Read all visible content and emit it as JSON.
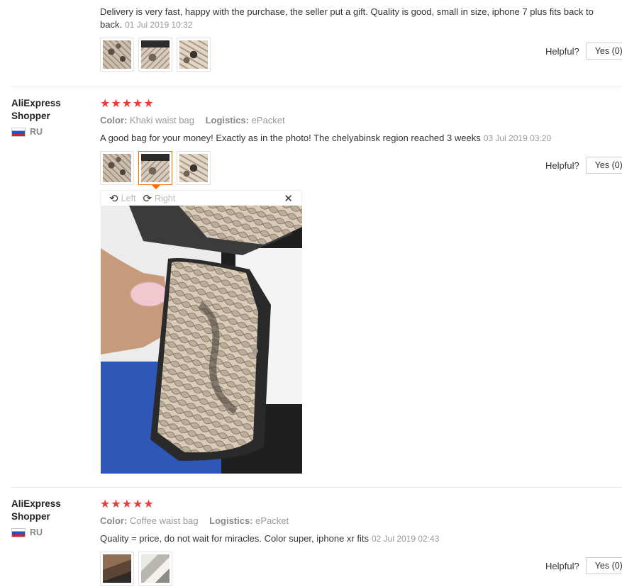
{
  "reviews": [
    {
      "text": "Delivery is very fast, happy with the purchase, the seller put a gift. Quality is good, small in size, iphone 7 plus fits back to back.",
      "date": "01 Jul 2019 10:32",
      "helpful_label": "Helpful?",
      "yes_label": "Yes (0)"
    },
    {
      "reviewer_line1": "AliExpress",
      "reviewer_line2": "Shopper",
      "country": "RU",
      "stars": "★★★★★",
      "color_label": "Color:",
      "color_value": "Khaki waist bag",
      "logistics_label": "Logistics:",
      "logistics_value": "ePacket",
      "text": "A good bag for your money! Exactly as in the photo! The chelyabinsk region reached 3 weeks",
      "date": "03 Jul 2019 03:20",
      "helpful_label": "Helpful?",
      "yes_label": "Yes (0)"
    },
    {
      "reviewer_line1": "AliExpress",
      "reviewer_line2": "Shopper",
      "country": "RU",
      "stars": "★★★★★",
      "color_label": "Color:",
      "color_value": "Coffee waist bag",
      "logistics_label": "Logistics:",
      "logistics_value": "ePacket",
      "text": "Quality = price, do not wait for miracles. Color super, iphone xr fits",
      "date": "02 Jul 2019 02:43",
      "helpful_label": "Helpful?",
      "yes_label": "Yes (0)"
    }
  ],
  "viewer": {
    "left_label": "Left",
    "right_label": "Right",
    "close_glyph": "✕",
    "rotate_left_glyph": "⟲",
    "rotate_right_glyph": "⟳"
  }
}
